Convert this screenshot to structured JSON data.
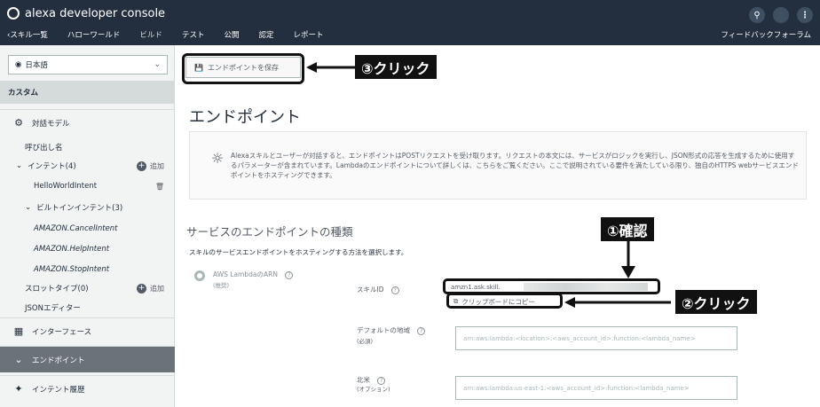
{
  "app": {
    "title": "alexa developer console"
  },
  "nav": {
    "back_label": "‹スキル一覧",
    "items": [
      "ハローワールド",
      "ビルド",
      "テスト",
      "公開",
      "認定",
      "レポート"
    ],
    "feedback_label": "フィードバックフォーラム"
  },
  "sidebar": {
    "language": "日本語",
    "section_header": "カスタム",
    "interaction_model": "対話モデル",
    "invocation_name": "呼び出し名",
    "intents_label": "インテント(4)",
    "add_label": "追加",
    "hello_intent": "HelloWorldIntent",
    "builtin_label": "ビルトインインテント(3)",
    "builtin_items": [
      "AMAZON.CancelIntent",
      "AMAZON.HelpIntent",
      "AMAZON.StopIntent"
    ],
    "slot_types_label": "スロットタイプ(0)",
    "json_editor": "JSONエディター",
    "interfaces": "インターフェース",
    "endpoint": "エンドポイント",
    "intent_history": "インテント履歴"
  },
  "main": {
    "save_button": "エンドポイントを保存",
    "title": "エンドポイント",
    "info_text": "Alexaスキルとユーザーが対話すると、エンドポイントはPOSTリクエストを受け取ります。リクエストの本文には、サービスがロジックを実行し、JSON形式の応答を生成するために使用するパラメーターが含まれています。Lambdaのエンドポイントについて詳しくは、こちらをご覧ください。ここで説明されている要件を満たしている限り、独自のHTTPS webサービスエンドポイントをホスティングできます。",
    "section_title": "サービスのエンドポイントの種類",
    "section_desc": "スキルのサービスエンドポイントをホスティングする方法を選択します。",
    "radio_label": "AWS LambdaのARN",
    "radio_sub": "(推奨)",
    "skill_id_label": "スキルID",
    "skill_id_value": "amzn1.ask.skill.",
    "copy_label": "クリップボードにコピー",
    "region_label": "デフォルトの地域",
    "region_sub": "(必須)",
    "region_placeholder": "arn:aws:lambda:<location>:<aws_account_id>:function:<lambda_name>",
    "na_label": "北米",
    "na_sub": "(オプション)",
    "na_placeholder": "arn:aws:lambda:us-east-1:<aws_account_id>:function:<lambda_name>"
  },
  "annotations": {
    "step1": "①確認",
    "step2": "②クリック",
    "step3": "③クリック"
  },
  "colors": {
    "topbar": "#232f3e",
    "sidebar": "#f2f3f3",
    "active_item": "#6b7278"
  }
}
